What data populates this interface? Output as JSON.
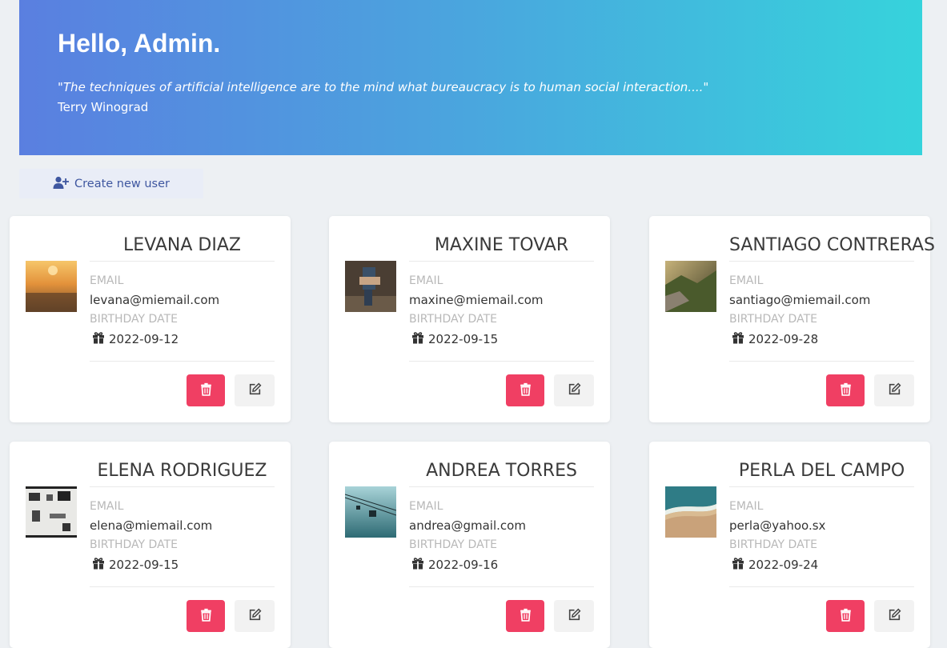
{
  "header": {
    "greeting": "Hello, Admin.",
    "quote": "\"The techniques of artificial intelligence are to the mind what bureaucracy is to human social interaction....\"",
    "author": "Terry Winograd"
  },
  "toolbar": {
    "create_label": "Create new user"
  },
  "labels": {
    "email": "EMAIL",
    "birthday": "BIRTHDAY DATE"
  },
  "colors": {
    "gradient_start": "#5a7fe0",
    "gradient_end": "#36d3dc",
    "delete": "#f03f63",
    "edit": "#f2f2f2",
    "background": "#edf0f3"
  },
  "users": [
    {
      "name": "LEVANA DIAZ",
      "email": "levana@miemail.com",
      "birthday": "2022-09-12",
      "photo": "sunset-city"
    },
    {
      "name": "MAXINE TOVAR",
      "email": "maxine@miemail.com",
      "birthday": "2022-09-15",
      "photo": "person-sitting"
    },
    {
      "name": "SANTIAGO CONTRERAS",
      "email": "santiago@miemail.com",
      "birthday": "2022-09-28",
      "photo": "mountain-cliff"
    },
    {
      "name": "ELENA RODRIGUEZ",
      "email": "elena@miemail.com",
      "birthday": "2022-09-15",
      "photo": "desk-objects"
    },
    {
      "name": "ANDREA TORRES",
      "email": "andrea@gmail.com",
      "birthday": "2022-09-16",
      "photo": "cable-car"
    },
    {
      "name": "PERLA DEL CAMPO",
      "email": "perla@yahoo.sx",
      "birthday": "2022-09-24",
      "photo": "beach-waves"
    }
  ],
  "icons": {
    "create": "user-plus-icon",
    "birthday": "gift-icon",
    "delete": "trash-icon",
    "edit": "edit-icon"
  }
}
